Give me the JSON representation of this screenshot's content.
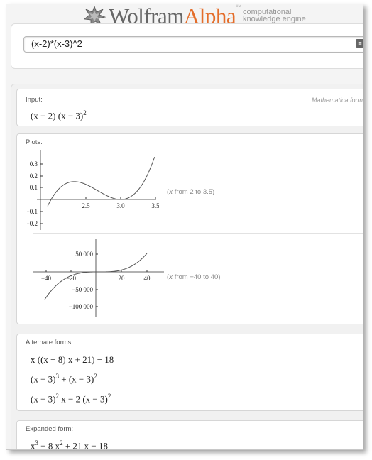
{
  "brand": {
    "wolfram": "Wolfram",
    "alpha": "Alpha",
    "tm": "™",
    "tagline_1": "computational",
    "tagline_2": "knowledge engine",
    "accent": "#e46d2a"
  },
  "search": {
    "value": "(x-2)*(x-3)^2"
  },
  "input_pod": {
    "title": "Input:",
    "aside": "Mathematica form",
    "expr_a": "(x − 2) (x − 3)",
    "expr_exp": "2"
  },
  "plots_pod": {
    "title": "Plots:",
    "plot1": {
      "range_var": "x",
      "range_text": " from 2 to 3.5)",
      "range_open": "(",
      "x_ticks": [
        "2.5",
        "3.0",
        "3.5"
      ],
      "y_ticks": [
        "0.3",
        "0.2",
        "0.1",
        "−0.1",
        "−0.2"
      ]
    },
    "plot2": {
      "range_var": "x",
      "range_text": " from −40 to 40)",
      "range_open": "(",
      "x_ticks": [
        "−40",
        "−20",
        "20",
        "40"
      ],
      "y_ticks": [
        "50 000",
        "−50 000",
        "−100 000"
      ]
    }
  },
  "alternate_pod": {
    "title": "Alternate forms:",
    "f1": "x ((x − 8) x + 21) − 18",
    "f2_a": "(x − 3)",
    "f2_e1": "3",
    "f2_b": " + (x − 3)",
    "f2_e2": "2",
    "f3_a": "(x − 3)",
    "f3_e1": "2",
    "f3_b": " x − 2 (x − 3)",
    "f3_e2": "2"
  },
  "expanded_pod": {
    "title": "Expanded form:",
    "a": "x",
    "e1": "3",
    "b": " − 8 x",
    "e2": "2",
    "c": " + 21 x − 18"
  },
  "chart_data": [
    {
      "type": "line",
      "series": [
        {
          "function": "(x-2)*(x-3)^2"
        }
      ],
      "xlim": [
        1.95,
        3.5
      ],
      "ylim": [
        -0.22,
        0.35
      ],
      "x_ticks": [
        2.5,
        3.0,
        3.5
      ],
      "y_ticks": [
        0.3,
        0.2,
        0.1,
        -0.1,
        -0.2
      ]
    },
    {
      "type": "line",
      "series": [
        {
          "function": "(x-2)*(x-3)^2"
        }
      ],
      "xlim": [
        -40,
        40
      ],
      "ylim": [
        -117000,
        84000
      ],
      "x_ticks": [
        -40,
        -20,
        20,
        40
      ],
      "y_ticks": [
        50000,
        -50000,
        -100000
      ]
    }
  ]
}
